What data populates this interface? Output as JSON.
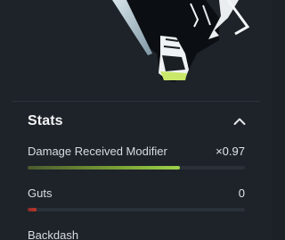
{
  "section": {
    "title": "Stats",
    "collapse_icon": "chevron-up-icon",
    "expanded": true
  },
  "stats": [
    {
      "label": "Damage Received Modifier",
      "value": "×0.97",
      "fill_fraction": 0.7,
      "color": "#9ed34a"
    },
    {
      "label": "Guts",
      "value": "0",
      "fill_fraction": 0.04,
      "color": "#c0392b"
    },
    {
      "label": "Backdash",
      "value": ""
    }
  ],
  "portrait": {
    "icon": "character-portrait",
    "colors": {
      "outline": "#f3f6f8",
      "accent": "#c9e86a",
      "shadow": "#0b0e12"
    }
  }
}
